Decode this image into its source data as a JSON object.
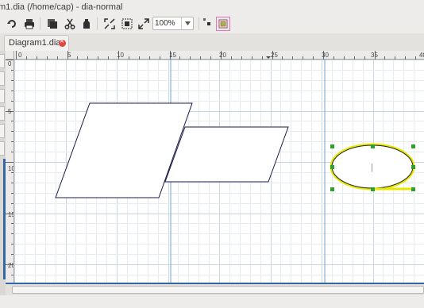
{
  "window": {
    "title": "m1.dia (/home/cap) - dia-normal"
  },
  "toolbar": {
    "zoom_value": "100%",
    "buttons": [
      {
        "name": "redo-icon"
      },
      {
        "name": "print-icon"
      },
      {
        "name": "copy-icon"
      },
      {
        "name": "cut-icon"
      },
      {
        "name": "paste-icon"
      },
      {
        "name": "zoom-fit-icon"
      },
      {
        "name": "zoom-100-icon"
      },
      {
        "name": "zoom-fit-width-icon"
      },
      {
        "name": "snap-to-grid-icon"
      },
      {
        "name": "snap-to-objects-icon"
      }
    ]
  },
  "tabs": [
    {
      "label": "Diagram1.dia",
      "active": true
    }
  ],
  "ruler": {
    "horizontal_labels": [
      "0",
      "5",
      "10",
      "15",
      "20",
      "25",
      "30",
      "35",
      "40"
    ],
    "vertical_labels": [
      "0",
      "5",
      "10",
      "15",
      "20"
    ]
  },
  "colors": {
    "selection_handle": "#2ea02e",
    "shape_outline": "#1a1a4a",
    "ellipse_highlight": "#e8e800",
    "accent_blue": "#3465a4",
    "guide_line": "#7aa0c8"
  },
  "canvas": {
    "objects": [
      {
        "type": "parallelogram",
        "selected": false
      },
      {
        "type": "parallelogram",
        "selected": false
      },
      {
        "type": "ellipse",
        "selected": true,
        "text": "|"
      }
    ]
  }
}
